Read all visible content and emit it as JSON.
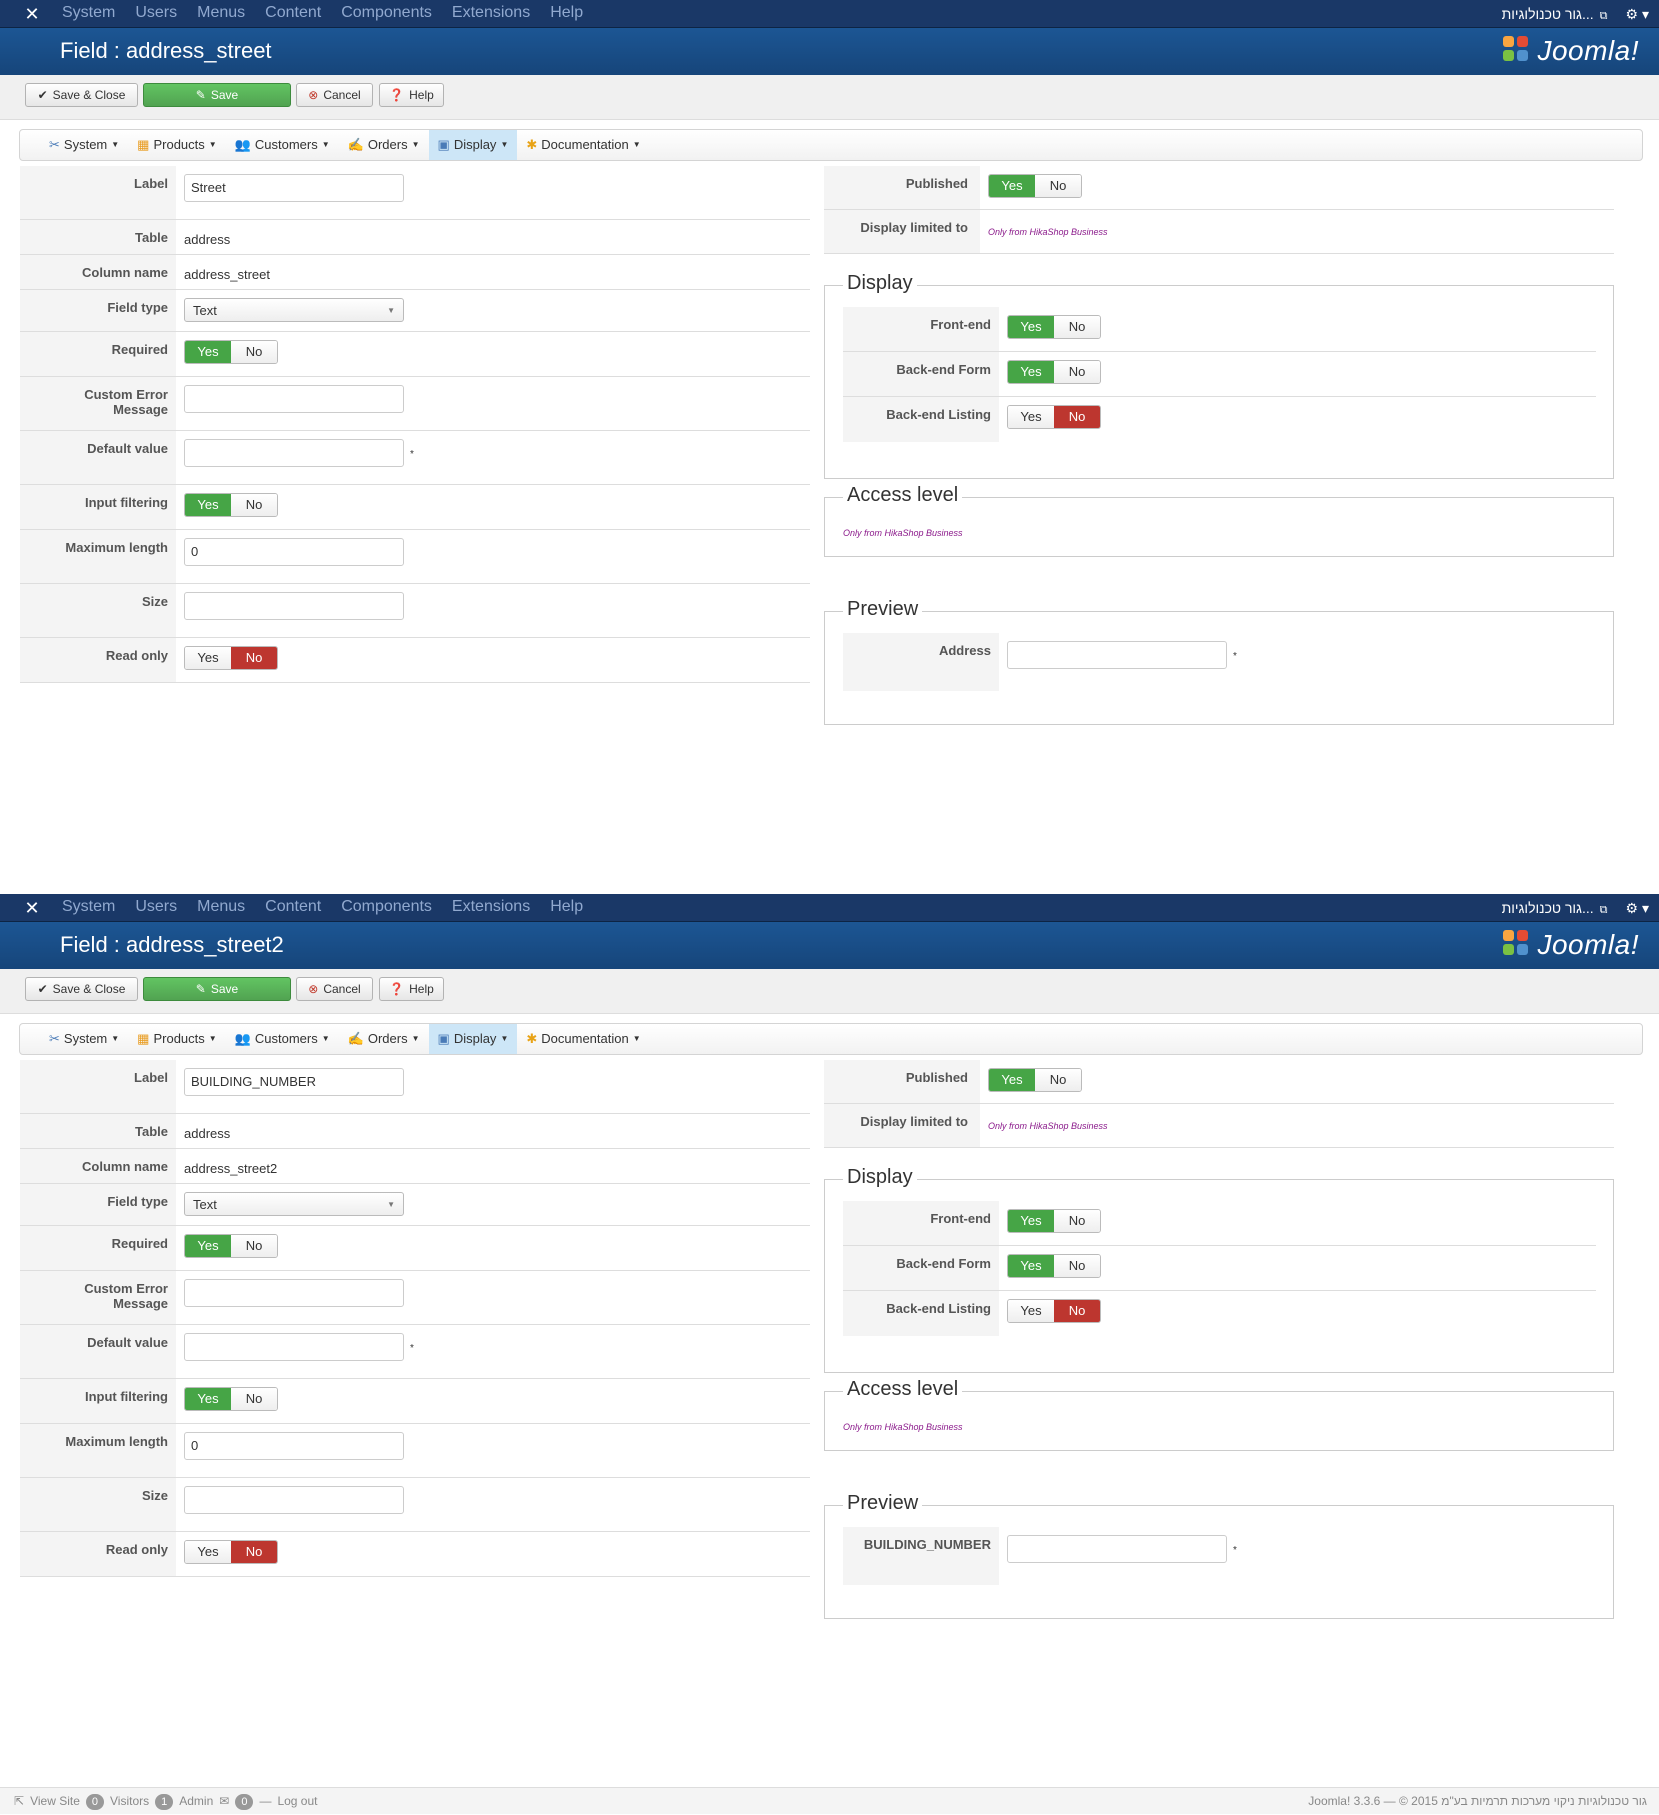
{
  "topnav": {
    "menu": [
      "System",
      "Users",
      "Menus",
      "Content",
      "Components",
      "Extensions",
      "Help"
    ],
    "site_name": "גור טכנולוגיות...",
    "gear_caret": "▾"
  },
  "toolbar": {
    "save_close": "Save & Close",
    "save": "Save",
    "cancel": "Cancel",
    "help": "Help"
  },
  "subnav": [
    "System",
    "Products",
    "Customers",
    "Orders",
    "Display",
    "Documentation"
  ],
  "brand": "Joomla!",
  "labels": {
    "label": "Label",
    "table": "Table",
    "column_name": "Column name",
    "field_type": "Field type",
    "required": "Required",
    "custom_error_1": "Custom Error",
    "custom_error_2": "Message",
    "default_value": "Default value",
    "input_filtering": "Input filtering",
    "maximum_length": "Maximum length",
    "size": "Size",
    "read_only": "Read only",
    "published": "Published",
    "display_limited_to": "Display limited to",
    "display_legend": "Display",
    "front_end": "Front-end",
    "backend_form": "Back-end Form",
    "backend_listing": "Back-end Listing",
    "access_level_legend": "Access level",
    "preview_legend": "Preview",
    "yes": "Yes",
    "no": "No",
    "star": "*",
    "hika_hint": "Only from HikaShop Business"
  },
  "screens": [
    {
      "title": "Field : address_street",
      "label_value": "Street",
      "table_value": "address",
      "column_value": "address_street",
      "field_type_value": "Text",
      "max_length_value": "0",
      "preview_label": "Address"
    },
    {
      "title": "Field : address_street2",
      "label_value": "BUILDING_NUMBER",
      "table_value": "address",
      "column_value": "address_street2",
      "field_type_value": "Text",
      "max_length_value": "0",
      "preview_label": "BUILDING_NUMBER"
    }
  ],
  "status": {
    "view_site": "View Site",
    "visitors_count": "0",
    "visitors": "Visitors",
    "admin_count": "1",
    "admin": "Admin",
    "messages_count": "0",
    "logout": "Log out",
    "version": "Joomla! 3.3.6  —  © 2015 גור טכנולוגיות ניקוי מערכות תרמיות בע\"מ"
  },
  "colors": {
    "topnav": "#1a3867",
    "header": "#1c5694",
    "green": "#46a546",
    "red": "#bd362f",
    "hint": "#8b1a8b"
  }
}
